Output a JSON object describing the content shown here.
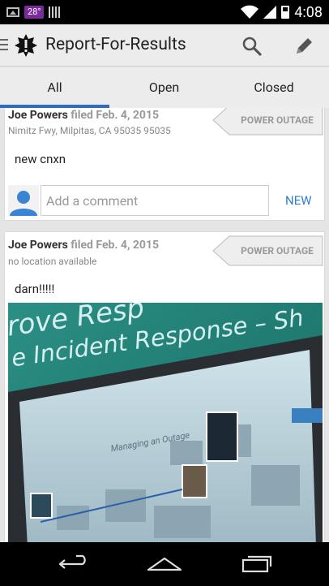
{
  "status_bar": {
    "temperature": "28°",
    "time": "4:08",
    "icons": [
      "image-icon",
      "grid-icon",
      "wifi-icon",
      "signal-icon",
      "battery-icon"
    ]
  },
  "app_bar": {
    "title": "Report-For-Results",
    "actions": [
      "search-icon",
      "edit-pencil-icon"
    ]
  },
  "tabs": [
    {
      "label": "All",
      "active": true
    },
    {
      "label": "Open",
      "active": false
    },
    {
      "label": "Closed",
      "active": false
    }
  ],
  "reports": [
    {
      "author": "Joe Powers",
      "filed": "filed Feb. 4, 2015",
      "location": "Nimitz Fwy, Milpitas, CA 95035 95035",
      "category": "POWER OUTAGE",
      "text": "new cnxn",
      "comment_placeholder": "Add a comment",
      "comment_action": "NEW"
    },
    {
      "author": "Joe Powers",
      "filed": "filed Feb. 4, 2015",
      "location": "no location available",
      "category": "POWER OUTAGE",
      "text": "darn!!!!!",
      "photo_text": [
        "rove Resp",
        "e Incident Response – Sh",
        "Managing an Outage"
      ]
    }
  ],
  "colors": {
    "accent": "#2e6cc4",
    "link": "#2e7cd0",
    "app_bar_bg": "#ececec",
    "feed_bg": "#e5e5e5"
  },
  "nav_bar": {
    "buttons": [
      "back-icon",
      "home-icon",
      "recents-icon"
    ]
  }
}
